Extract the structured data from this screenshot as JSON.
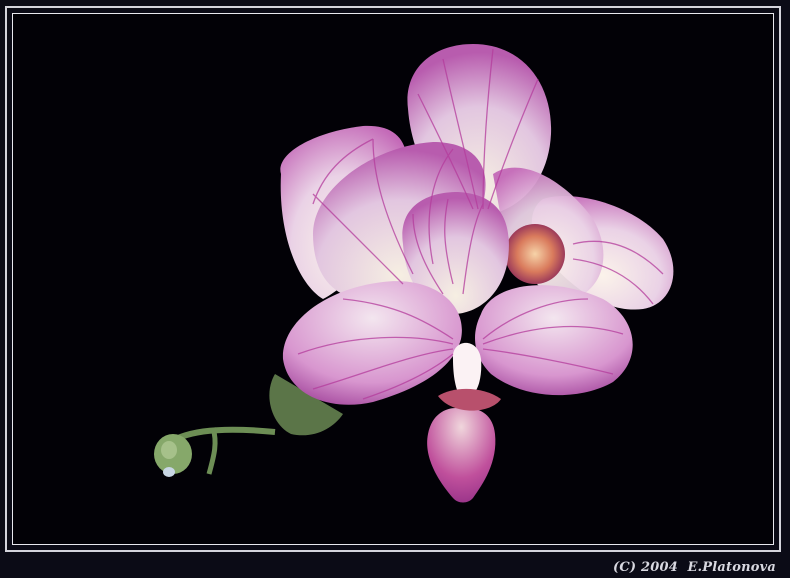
{
  "photo": {
    "subject": "pink-striped orchid flower with bud on black background",
    "colors": {
      "background": "#020106",
      "petal_light": "#f3e3ee",
      "petal_vein": "#b43c9c",
      "stem": "#7fa060"
    }
  },
  "caption": {
    "text": "(C) 2004  E.Platonova"
  }
}
